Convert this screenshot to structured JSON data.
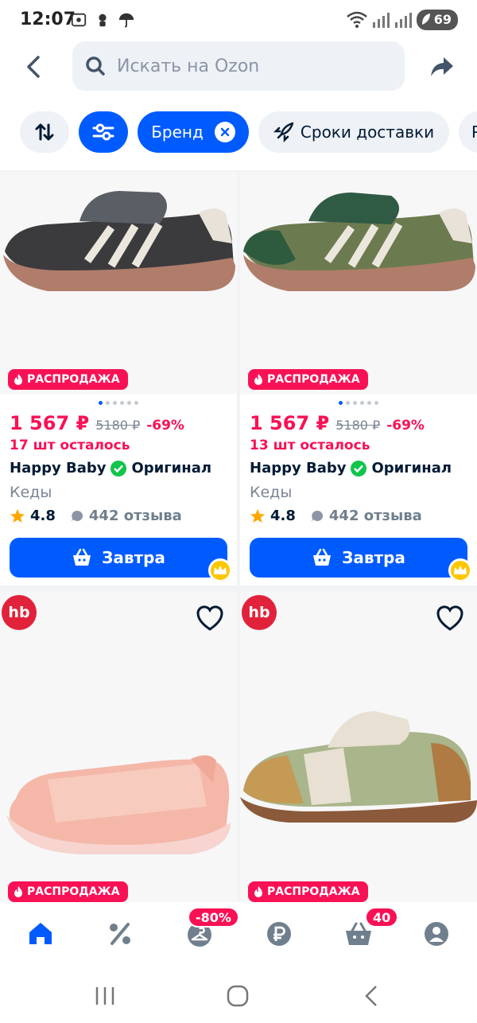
{
  "status_bar": {
    "time": "12:07",
    "battery": "69"
  },
  "search": {
    "placeholder": "Искать на Ozon"
  },
  "filters": {
    "brand": "Бренд",
    "delivery": "Сроки доставки",
    "next": "Р"
  },
  "products": [
    {
      "sale_label": "РАСПРОДАЖА",
      "price": "1 567 ₽",
      "old_price": "5180 ₽",
      "discount": "-69%",
      "stock": "17 шт осталось",
      "brand": "Happy Baby",
      "original": "Оригинал",
      "type": "Кеды",
      "rating": "4.8",
      "reviews": "442 отзыва",
      "buy_label": "Завтра"
    },
    {
      "sale_label": "РАСПРОДАЖА",
      "price": "1 567 ₽",
      "old_price": "5180 ₽",
      "discount": "-69%",
      "stock": "13 шт осталось",
      "brand": "Happy Baby",
      "original": "Оригинал",
      "type": "Кеды",
      "rating": "4.8",
      "reviews": "442 отзыва",
      "buy_label": "Завтра"
    },
    {
      "brand_logo": "hb",
      "sale_label": "РАСПРОДАЖА"
    },
    {
      "brand_logo": "hb",
      "sale_label": "РАСПРОДАЖА"
    }
  ],
  "bottom_nav": {
    "fresh_badge": "-80%",
    "cart_badge": "40"
  },
  "colors": {
    "accent": "#005bff",
    "sale": "#f91155",
    "original_check": "#10c44c",
    "premium": "#ffc700"
  }
}
